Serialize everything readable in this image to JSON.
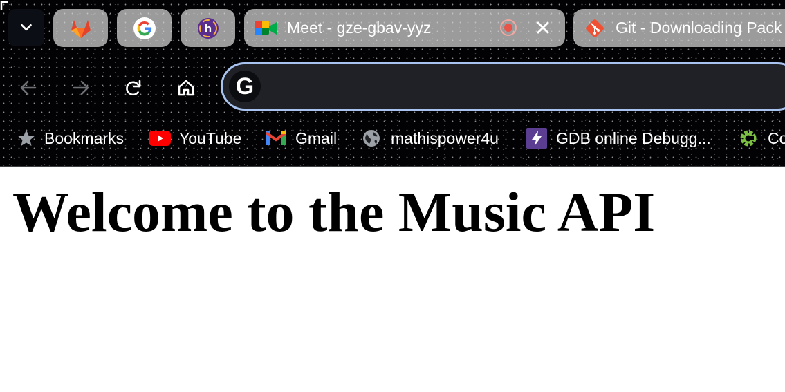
{
  "browser": {
    "tab_search_icon": "chevron-down-icon",
    "pinned_tabs": [
      {
        "icon": "gitlab-icon"
      },
      {
        "icon": "google-icon"
      },
      {
        "icon": "h-logo-icon"
      }
    ],
    "tabs": [
      {
        "title": "Meet - gze-gbav-yyz",
        "icon": "google-meet-icon",
        "active": true
      },
      {
        "title": "Git - Downloading Pack",
        "icon": "git-icon",
        "active": false
      }
    ],
    "nav": {
      "back_icon": "back-arrow-icon",
      "forward_icon": "forward-arrow-icon",
      "reload_icon": "reload-icon",
      "home_icon": "home-icon"
    },
    "omnibox": {
      "engine_letter": "G",
      "value": ""
    },
    "bookmarks": [
      {
        "label": "Bookmarks",
        "icon": "star-icon"
      },
      {
        "label": "YouTube",
        "icon": "youtube-icon"
      },
      {
        "label": "Gmail",
        "icon": "gmail-icon"
      },
      {
        "label": "mathispower4u",
        "icon": "globe-icon"
      },
      {
        "label": "GDB online Debugg...",
        "icon": "lightning-icon"
      },
      {
        "label": "Co",
        "icon": "gear-icon"
      }
    ],
    "colors": {
      "omnibox_border": "#a8c3f0",
      "tab_bg": "#d7d7d7",
      "bookmark_gear": "#7cc043"
    }
  },
  "page": {
    "heading": "Welcome to the Music API"
  }
}
